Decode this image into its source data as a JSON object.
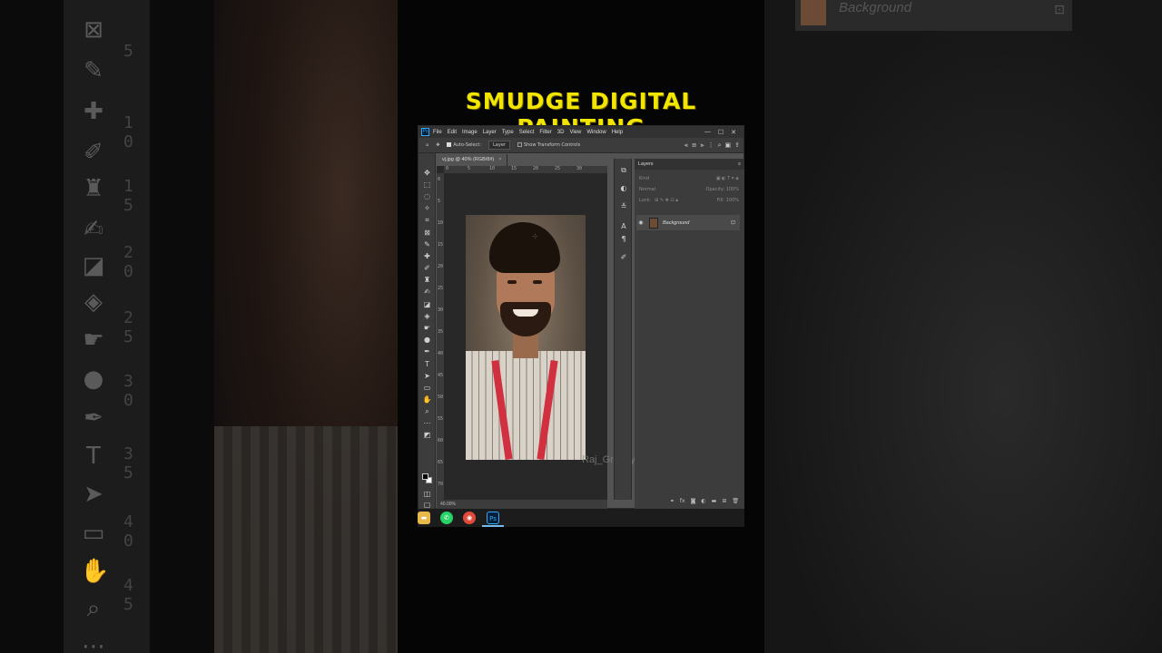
{
  "title": "SMUDGE DIGITAL PAINTING",
  "menu": [
    "File",
    "Edit",
    "Image",
    "Layer",
    "Type",
    "Select",
    "Filter",
    "3D",
    "View",
    "Window",
    "Help"
  ],
  "ps_logo": "Ps",
  "window_buttons": [
    "—",
    "☐",
    "✕"
  ],
  "options": {
    "auto_select_label": "Auto-Select:",
    "auto_select_value": "Layer",
    "transform_label": "Show Transform Controls"
  },
  "doc_tab": {
    "label": "vj.jpg @ 40% (RGB/8#)",
    "close": "×"
  },
  "ruler_h": [
    "0",
    "5",
    "10",
    "15",
    "20",
    "25",
    "30"
  ],
  "ruler_v": [
    "0",
    "5",
    "10",
    "15",
    "20",
    "25",
    "30",
    "35",
    "40",
    "45",
    "50",
    "55",
    "60",
    "65",
    "70"
  ],
  "zoom": "40.00%",
  "watermark": "Raj_Graphy_",
  "layers_panel": {
    "tab": "Layers",
    "menu_icon": "≡",
    "kind_label": "Kind",
    "blend_mode": "Normal",
    "opacity_label": "Opacity:",
    "opacity_value": "100%",
    "lock_label": "Lock:",
    "fill_label": "Fill:",
    "fill_value": "100%",
    "layer": {
      "name": "Background",
      "visible": true,
      "locked": true
    }
  },
  "side_right_layer_label": "Background",
  "taskbar": {
    "apps": [
      {
        "name": "file-explorer",
        "color": "#e8b84a",
        "glyph": "▬"
      },
      {
        "name": "whatsapp",
        "color": "#25d366",
        "glyph": "✆"
      },
      {
        "name": "chrome",
        "color": "#e04a3a",
        "glyph": "◉"
      },
      {
        "name": "photoshop",
        "color": "#001e36",
        "glyph": "Ps",
        "active": true
      }
    ]
  },
  "colors": {
    "title_yellow": "#f2e600",
    "ps_blue": "#31a8ff",
    "panel_bg": "#3c3c3c"
  }
}
